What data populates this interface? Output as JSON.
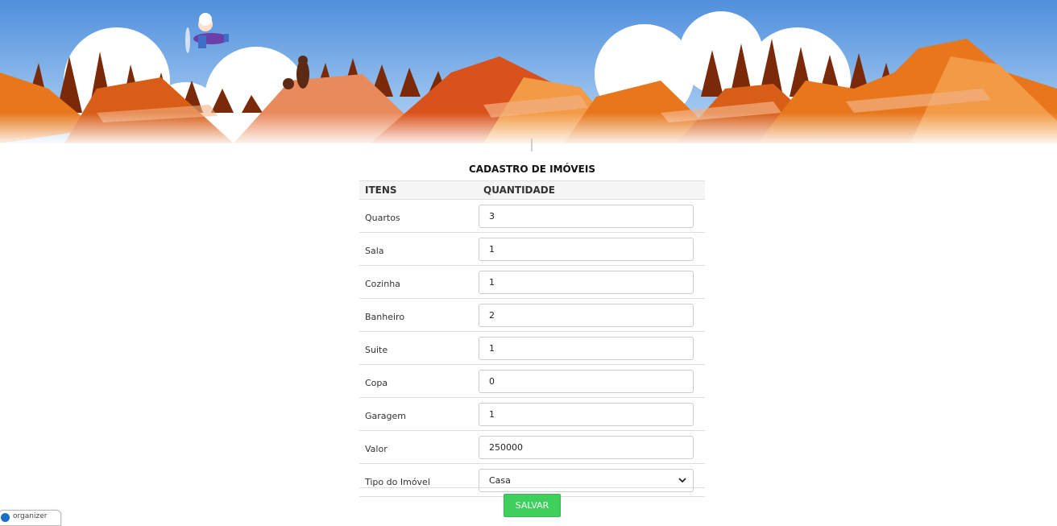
{
  "form": {
    "title": "CADASTRO DE IMÓVEIS",
    "headers": {
      "items": "ITENS",
      "quantity": "QUANTIDADE"
    },
    "rows": [
      {
        "label": "Quartos",
        "value": "3"
      },
      {
        "label": "Sala",
        "value": "1"
      },
      {
        "label": "Cozinha",
        "value": "1"
      },
      {
        "label": "Banheiro",
        "value": "2"
      },
      {
        "label": "Suite",
        "value": "1"
      },
      {
        "label": "Copa",
        "value": "0"
      },
      {
        "label": "Garagem",
        "value": "1"
      },
      {
        "label": "Valor",
        "value": "250000"
      }
    ],
    "type_row": {
      "label": "Tipo do Imóvel",
      "selected": "Casa"
    },
    "save_label": "SALVAR"
  },
  "badge": {
    "label": "organizer"
  },
  "colors": {
    "sky": "#5b9be0",
    "mountain_orange": "#e8771c",
    "forest": "#7a2a08",
    "save_button": "#3fcf5c"
  }
}
